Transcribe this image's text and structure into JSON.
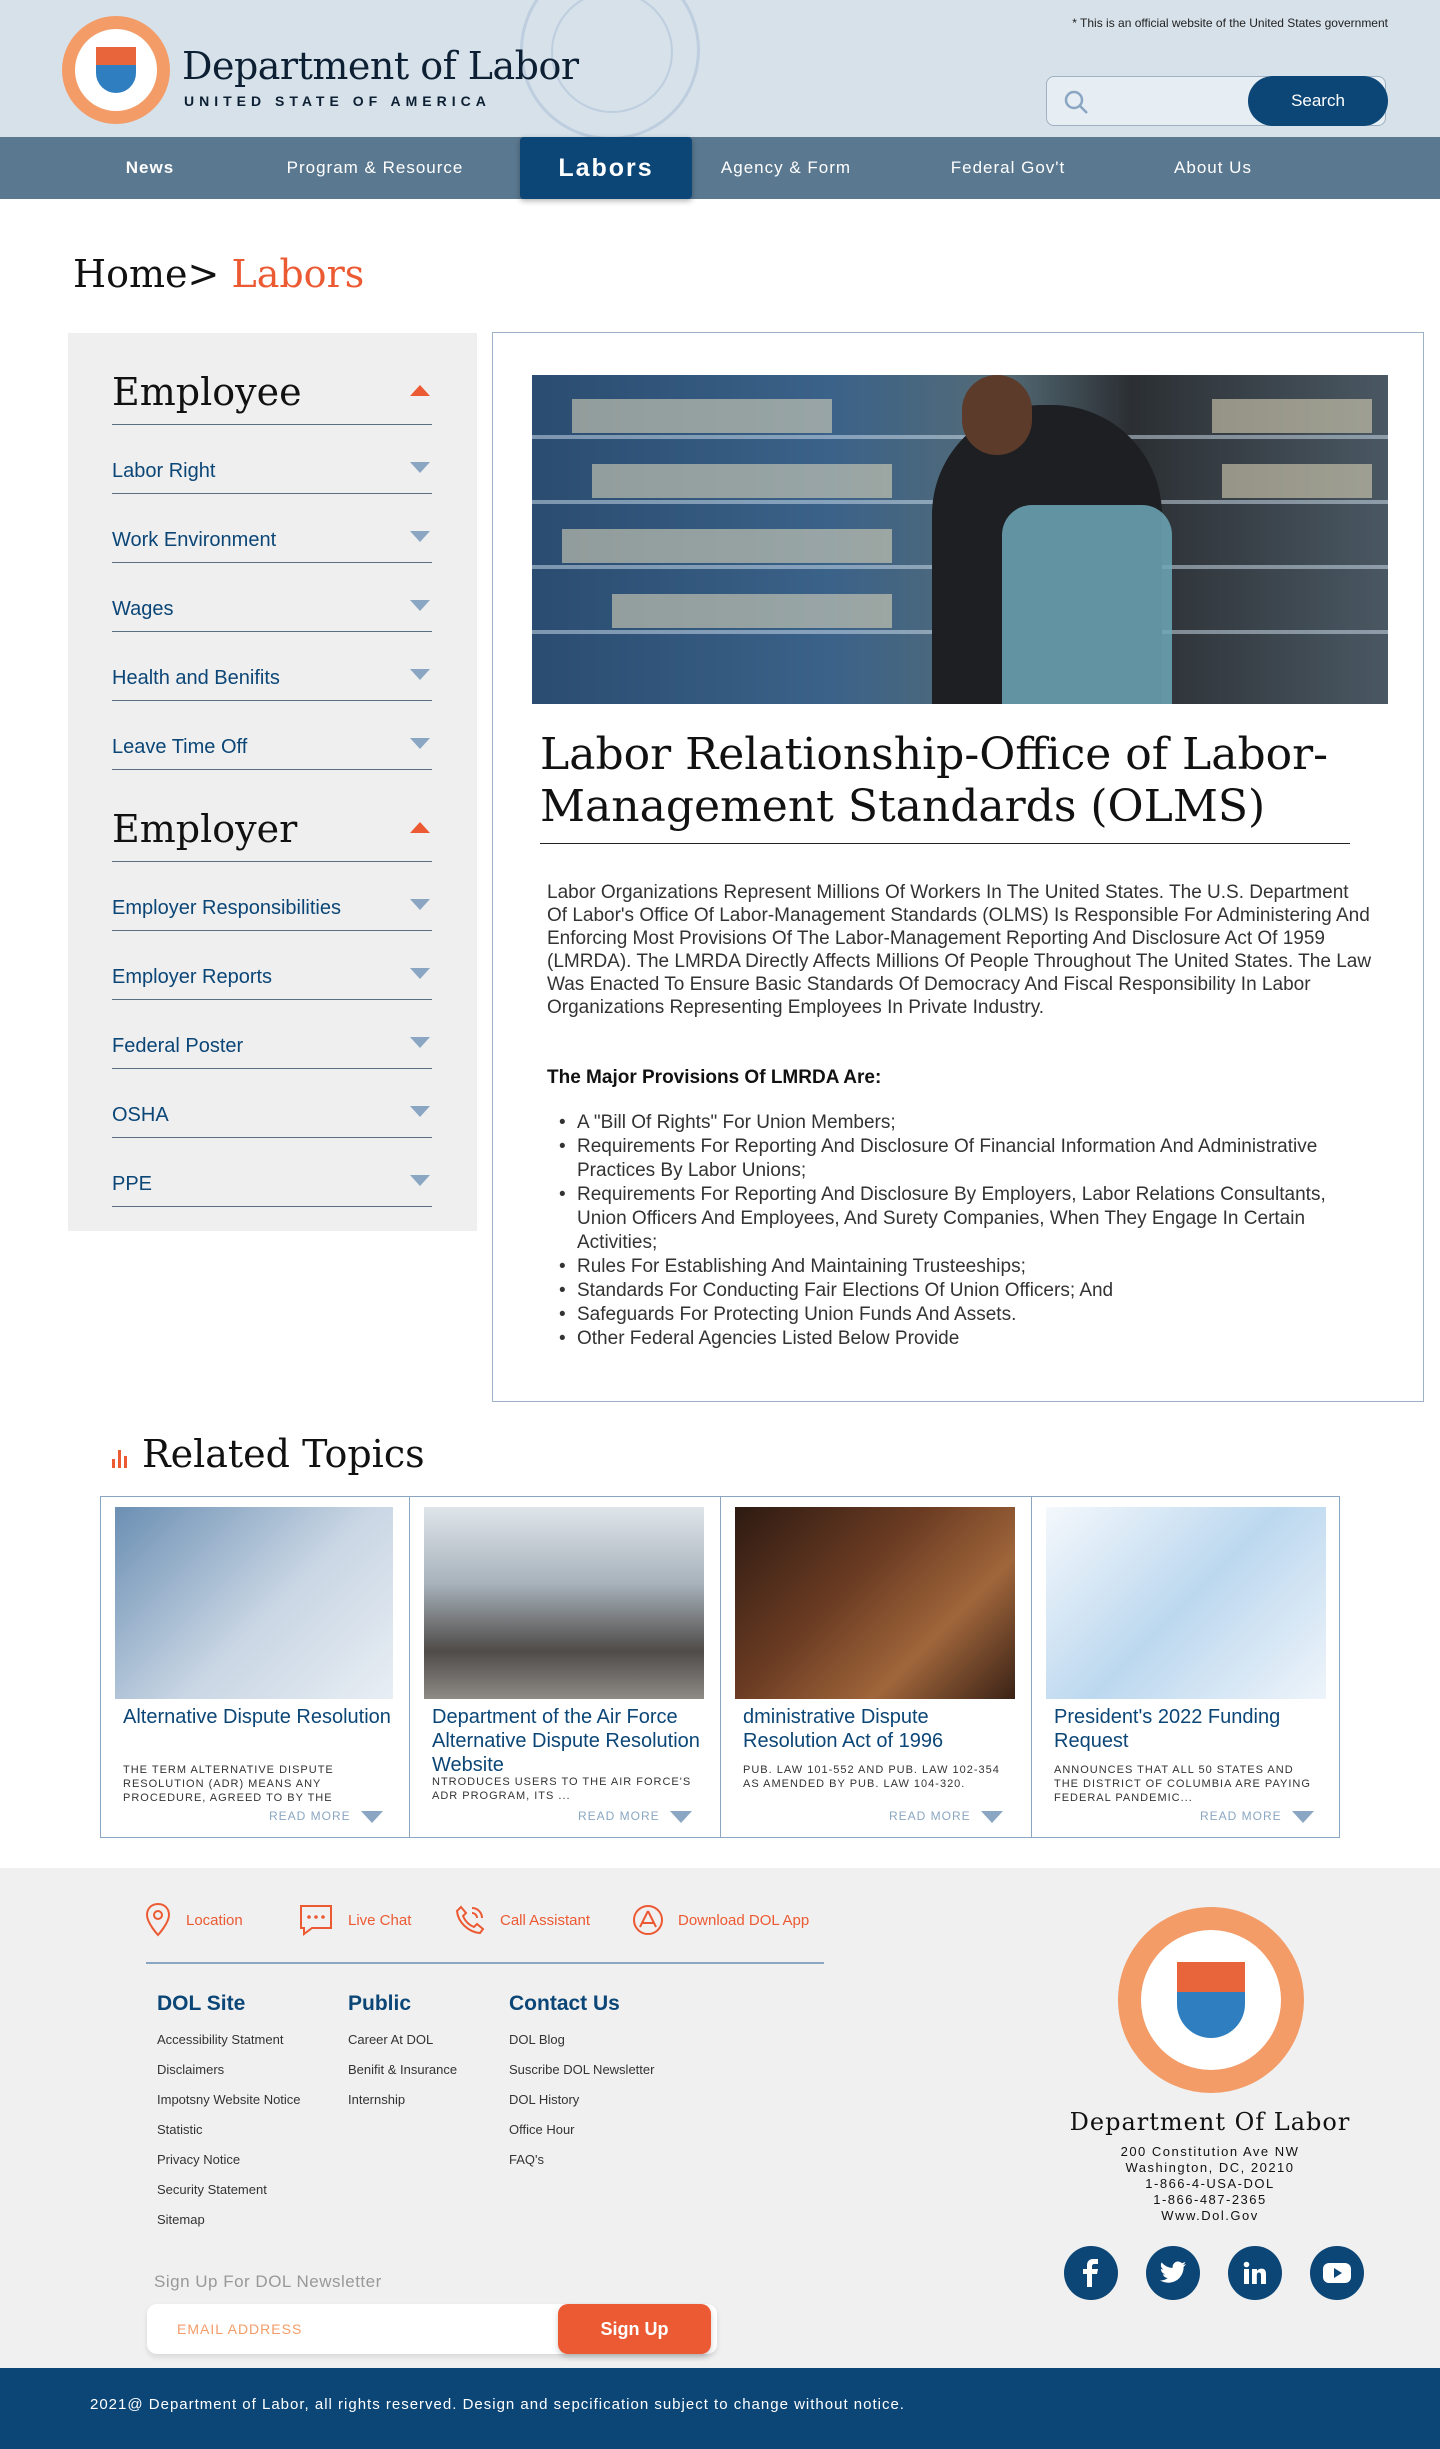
{
  "header": {
    "title": "Department of Labor",
    "subtitle": "UNITED STATE OF AMERICA",
    "official_notice": "* This is an official website of the United States government",
    "search_placeholder": "",
    "search_button": "Search"
  },
  "nav": {
    "items": [
      "News",
      "Program & Resource",
      "Labors",
      "Agency & Form",
      "Federal Gov't",
      "About Us"
    ],
    "active": "Labors"
  },
  "breadcrumb": {
    "home": "Home>",
    "current": " Labors"
  },
  "sidebar": {
    "employee_heading": "Employee",
    "employee_items": [
      "Labor Right",
      "Work Environment",
      "Wages",
      "Health and Benifits",
      "Leave Time Off"
    ],
    "employer_heading": "Employer",
    "employer_items": [
      "Employer Responsibilities",
      "Employer Reports",
      "Federal Poster",
      "OSHA",
      "PPE"
    ]
  },
  "article": {
    "title": "Labor Relationship-Office of Labor-Management Standards (OLMS)",
    "body": "Labor Organizations Represent Millions Of Workers In The United States. The U.S. Department Of Labor's Office Of Labor-Management Standards (OLMS) Is Responsible For Administering And Enforcing Most Provisions Of The Labor-Management Reporting And Disclosure Act Of 1959 (LMRDA). The LMRDA Directly Affects Millions Of People Throughout The United States. The Law Was Enacted To Ensure Basic Standards Of Democracy And Fiscal Responsibility In Labor Organizations Representing Employees In Private Industry.",
    "provisions_heading": "The Major Provisions Of LMRDA Are:",
    "provisions": [
      "A \"Bill Of Rights\" For Union Members;",
      "Requirements For Reporting And Disclosure Of Financial Information And Administrative Practices By Labor Unions;",
      "Requirements For Reporting And Disclosure By Employers, Labor Relations Consultants, Union Officers And Employees, And Surety Companies, When They Engage In Certain Activities;",
      "Rules For Establishing And Maintaining Trusteeships;",
      "Standards For Conducting Fair Elections Of Union Officers; And",
      "Safeguards For Protecting Union Funds And Assets.",
      "Other Federal Agencies Listed Below Provide"
    ]
  },
  "related": {
    "heading": "Related Topics",
    "read_more": "READ MORE",
    "cards": [
      {
        "title": "Alternative Dispute Resolution",
        "desc": "THE TERM ALTERNATIVE DISPUTE RESOLUTION (ADR) MEANS ANY PROCEDURE, AGREED TO BY THE"
      },
      {
        "title": "Department of the Air Force Alternative Dispute Resolution Website",
        "desc": "NTRODUCES USERS TO THE AIR FORCE'S ADR PROGRAM, ITS ..."
      },
      {
        "title": "dministrative Dispute Resolution Act of 1996",
        "desc": "PUB. LAW 101-552 AND PUB. LAW 102-354 AS AMENDED BY PUB. LAW 104-320."
      },
      {
        "title": "President's 2022 Funding Request",
        "desc": "ANNOUNCES THAT ALL 50 STATES AND THE DISTRICT OF COLUMBIA ARE PAYING FEDERAL PANDEMIC..."
      }
    ]
  },
  "footer": {
    "quick": [
      "Location",
      "Live Chat",
      "Call Assistant",
      "Download DOL App"
    ],
    "dol_site": {
      "heading": "DOL Site",
      "links": [
        "Accessibility Statment",
        "Disclaimers",
        "Impotsny Website Notice",
        "Statistic",
        "Privacy Notice",
        "Security Statement",
        "Sitemap"
      ]
    },
    "public": {
      "heading": "Public",
      "links": [
        "Career At DOL",
        "Benifit & Insurance",
        "Internship"
      ]
    },
    "contact": {
      "heading": "Contact Us",
      "links": [
        "DOL Blog",
        "Suscribe DOL Newsletter",
        "DOL History",
        "Office Hour",
        "FAQ's"
      ]
    },
    "newsletter_label": "Sign Up For DOL Newsletter",
    "newsletter_placeholder": "EMAIL ADDRESS",
    "newsletter_button": "Sign Up",
    "org_name": "Department Of Labor",
    "address": [
      "200 Constitution Ave NW",
      "Washington, DC, 20210",
      "1-866-4-USA-DOL",
      "1-866-487-2365",
      "Www.Dol.Gov"
    ],
    "copyright": "2021@ Department of Labor, all rights reserved.  Design and sepcification subject to change without notice."
  },
  "colors": {
    "navy": "#0b4677",
    "accent": "#ec5a33",
    "nav_bg": "#5a7890",
    "header_bg": "#d6e1ea"
  }
}
